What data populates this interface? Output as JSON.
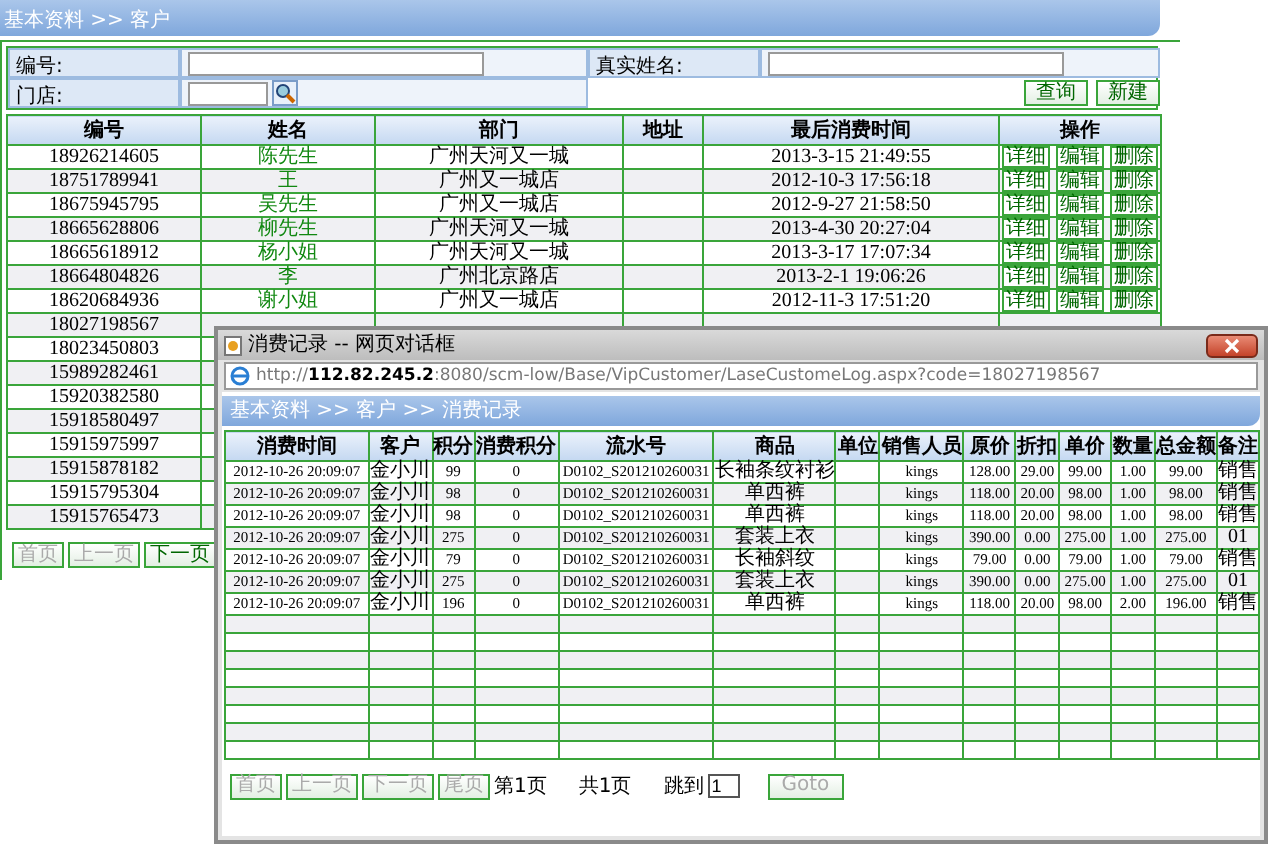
{
  "breadcrumb": "基本资料 >> 客户",
  "search_form": {
    "fields": [
      {
        "label": "编号:",
        "kind": "text"
      },
      {
        "label": "真实姓名:",
        "kind": "text"
      },
      {
        "label": "门店:",
        "kind": "lookup"
      }
    ],
    "buttons": [
      "查询",
      "新建"
    ]
  },
  "table": {
    "columns": [
      "编号",
      "姓名",
      "部门",
      "地址",
      "最后消费时间",
      "操作"
    ],
    "rows": [
      {
        "number": "18926214605",
        "name": "陈先生",
        "dept": "广州天河又一城",
        "time": "2013-3-15 21:49:55",
        "actions": [
          "详细",
          "编辑",
          "删除"
        ]
      },
      {
        "number": "18751789941",
        "name": "王",
        "dept": "广州又一城店",
        "time": "2012-10-3 17:56:18",
        "actions": [
          "详细",
          "编辑",
          "删除"
        ]
      },
      {
        "number": "18675945795",
        "name": "吴先生",
        "dept": "广州又一城店",
        "time": "2012-9-27 21:58:50",
        "actions": [
          "详细",
          "编辑",
          "删除"
        ]
      },
      {
        "number": "18665628806",
        "name": "柳先生",
        "dept": "广州天河又一城",
        "time": "2013-4-30 20:27:04",
        "actions": [
          "详细",
          "编辑",
          "删除"
        ]
      },
      {
        "number": "18665618912",
        "name": "杨小姐",
        "dept": "广州天河又一城",
        "time": "2013-3-17 17:07:34",
        "actions": [
          "详细",
          "编辑",
          "删除"
        ]
      },
      {
        "number": "18664804826",
        "name": "李",
        "dept": "广州北京路店",
        "time": "2013-2-1 19:06:26",
        "actions": [
          "详细",
          "编辑",
          "删除"
        ]
      },
      {
        "number": "18620684936",
        "name": "谢小姐",
        "dept": "广州又一城店",
        "time": "2012-11-3 17:51:20",
        "actions": [
          "详细",
          "编辑",
          "删除"
        ]
      },
      {
        "number": "18027198567"
      },
      {
        "number": "18023450803"
      },
      {
        "number": "15989282461"
      },
      {
        "number": "15920382580"
      },
      {
        "number": "15918580497"
      },
      {
        "number": "15915975997"
      },
      {
        "number": "15915878182"
      },
      {
        "number": "15915795304"
      },
      {
        "number": "15915765473"
      }
    ]
  },
  "pager": [
    {
      "label": "首页",
      "disabled": true
    },
    {
      "label": "上一页",
      "disabled": true
    },
    {
      "label": "下一页",
      "disabled": false
    }
  ],
  "dialog": {
    "title": "消费记录 -- 网页对话框",
    "url": "http://**112.82.245.2**:8080/scm-low/Base/VipCustomer/LaseCustomeLog.aspx?code=18027198567",
    "breadcrumb": "基本资料 >> 客户 >> 消费记录",
    "columns": [
      "消费时间",
      "客户",
      "积分",
      "消费积分",
      "流水号",
      "商品",
      "单位",
      "销售人员",
      "原价",
      "折扣",
      "单价",
      "数量",
      "总金额",
      "备注"
    ],
    "rows": [
      [
        "2012-10-26 20:09:07",
        "金小川",
        "99",
        "0",
        "D0102_S201210260031",
        "长袖条纹衬衫",
        "",
        "kings",
        "128.00",
        "29.00",
        "99.00",
        "1.00",
        "99.00",
        "销售"
      ],
      [
        "2012-10-26 20:09:07",
        "金小川",
        "98",
        "0",
        "D0102_S201210260031",
        "单西裤",
        "",
        "kings",
        "118.00",
        "20.00",
        "98.00",
        "1.00",
        "98.00",
        "销售"
      ],
      [
        "2012-10-26 20:09:07",
        "金小川",
        "98",
        "0",
        "D0102_S201210260031",
        "单西裤",
        "",
        "kings",
        "118.00",
        "20.00",
        "98.00",
        "1.00",
        "98.00",
        "销售"
      ],
      [
        "2012-10-26 20:09:07",
        "金小川",
        "275",
        "0",
        "D0102_S201210260031",
        "套装上衣",
        "",
        "kings",
        "390.00",
        "0.00",
        "275.00",
        "1.00",
        "275.00",
        "01"
      ],
      [
        "2012-10-26 20:09:07",
        "金小川",
        "79",
        "0",
        "D0102_S201210260031",
        "长袖斜纹",
        "",
        "kings",
        "79.00",
        "0.00",
        "79.00",
        "1.00",
        "79.00",
        "销售"
      ],
      [
        "2012-10-26 20:09:07",
        "金小川",
        "275",
        "0",
        "D0102_S201210260031",
        "套装上衣",
        "",
        "kings",
        "390.00",
        "0.00",
        "275.00",
        "1.00",
        "275.00",
        "01"
      ],
      [
        "2012-10-26 20:09:07",
        "金小川",
        "196",
        "0",
        "D0102_S201210260031",
        "单西裤",
        "",
        "kings",
        "118.00",
        "20.00",
        "98.00",
        "2.00",
        "196.00",
        "销售"
      ]
    ],
    "pager": [
      {
        "label": "首页",
        "disabled": true
      },
      {
        "label": "上一页",
        "disabled": true
      },
      {
        "label": "下一页",
        "disabled": true
      },
      {
        "label": "尾页",
        "disabled": true
      }
    ],
    "page_label": "第1页",
    "total_label": "共1页",
    "jump_label": "跳到",
    "jump_value": "1",
    "goto": {
      "label": "Goto",
      "disabled": true
    }
  }
}
